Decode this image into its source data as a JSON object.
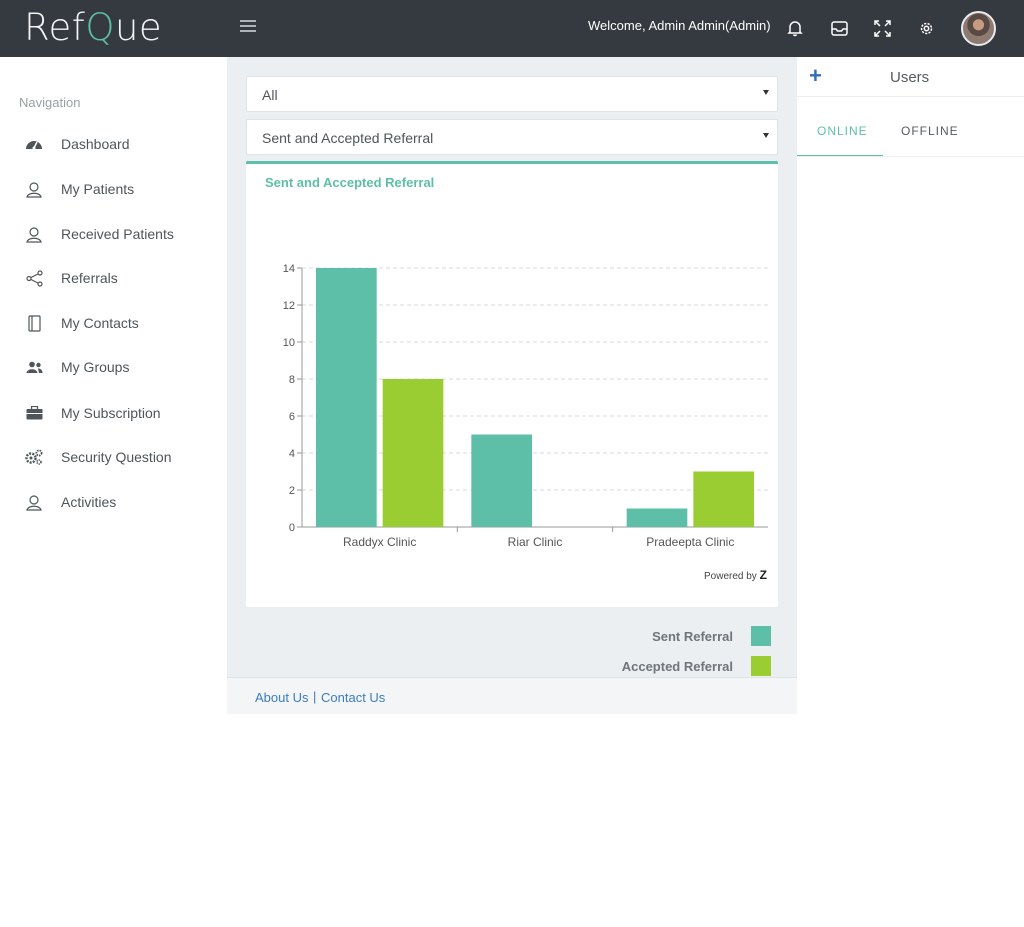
{
  "header": {
    "logo_part1": "Ref",
    "logo_q": "Q",
    "logo_part2": "ue",
    "welcome": "Welcome, Admin Admin(Admin)"
  },
  "sidebar": {
    "title": "Navigation",
    "items": [
      {
        "label": "Dashboard",
        "icon": "dashboard-icon"
      },
      {
        "label": "My Patients",
        "icon": "patients-icon"
      },
      {
        "label": "Received Patients",
        "icon": "received-patients-icon"
      },
      {
        "label": "Referrals",
        "icon": "share-icon"
      },
      {
        "label": "My Contacts",
        "icon": "contacts-book-icon"
      },
      {
        "label": "My Groups",
        "icon": "groups-icon"
      },
      {
        "label": "My Subscription",
        "icon": "briefcase-icon"
      },
      {
        "label": "Security Question",
        "icon": "cogs-icon"
      },
      {
        "label": "Activities",
        "icon": "activities-icon"
      }
    ]
  },
  "filters": {
    "select1_value": "All",
    "select2_value": "Sent and Accepted Referral"
  },
  "card": {
    "title": "Sent and Accepted Referral",
    "powered_text": "Powered by",
    "powered_mark": "Z"
  },
  "chart_data": {
    "type": "bar",
    "categories": [
      "Raddyx Clinic",
      "Riar Clinic",
      "Pradeepta Clinic"
    ],
    "series": [
      {
        "name": "Sent Referral",
        "values": [
          14,
          5,
          1
        ],
        "color": "#5dbfa7"
      },
      {
        "name": "Accepted Referral",
        "values": [
          8,
          0,
          3
        ],
        "color": "#9acd32"
      }
    ],
    "ylim": [
      0,
      14
    ],
    "yticks": [
      0,
      2,
      4,
      6,
      8,
      10,
      12,
      14
    ],
    "grid": true,
    "legend_position": "bottom-right"
  },
  "footer": {
    "about": "About Us",
    "separator": "|",
    "contact": "Contact Us"
  },
  "users_panel": {
    "plus": "+",
    "title": "Users",
    "tab_online": "ONLINE",
    "tab_offline": "OFFLINE"
  },
  "colors": {
    "accent": "#5dbfa7",
    "header_bg": "#343a40",
    "link": "#3c7dbd"
  }
}
